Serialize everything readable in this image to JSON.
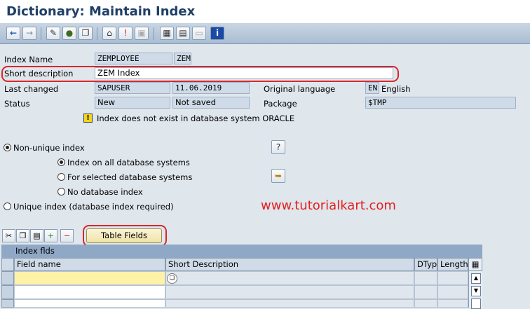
{
  "window": {
    "title": "Dictionary: Maintain Index"
  },
  "toolbar": {
    "icons": [
      "back-arrow-icon",
      "forward-arrow-icon",
      "edit-toggle-icon",
      "other-object-icon",
      "activate-icon",
      "where-used-icon",
      "check-icon",
      "object-list-icon",
      "hierarchy-icon",
      "display-object-icon",
      "layout-icon",
      "info-icon"
    ]
  },
  "header": {
    "index_name_label": "Index Name",
    "index_name_value": "ZEMPLOYEE",
    "index_id_value": "ZEM",
    "short_desc_label": "Short description",
    "short_desc_value": "ZEM Index",
    "last_changed_label": "Last changed",
    "last_changed_user": "SAPUSER",
    "last_changed_date": "11.06.2019",
    "orig_lang_label": "Original language",
    "orig_lang_code": "EN",
    "orig_lang_name": "English",
    "status_label": "Status",
    "status_value": "New",
    "save_status": "Not saved",
    "package_label": "Package",
    "package_value": "$TMP",
    "warning_text": "Index does not exist in database system ORACLE"
  },
  "options": {
    "non_unique": "Non-unique index",
    "all_db": "Index on all database systems",
    "selected_db": "For selected database systems",
    "no_db": "No database index",
    "unique": "Unique index (database index required)",
    "selected": "Non-unique index / Index on all database systems"
  },
  "watermark": "www.tutorialkart.com",
  "table_fields_button": "Table Fields",
  "grid": {
    "title": "Index flds",
    "columns": [
      "Field name",
      "Short Description",
      "DTyp",
      "Length"
    ]
  },
  "colors": {
    "title": "#1f3f66",
    "highlight": "#d9262b",
    "watermark": "#e41e1e",
    "input_active": "#fdf2a7"
  }
}
